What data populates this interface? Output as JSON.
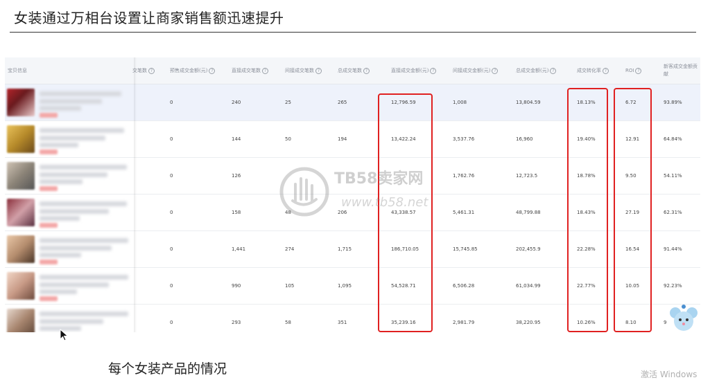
{
  "slide": {
    "title": "女装通过万相台设置让商家销售额迅速提升",
    "caption": "每个女装产品的情况",
    "os_watermark": "激活 Windows"
  },
  "watermark": {
    "line1": "TB58卖家网",
    "line2": "www.tb58.net"
  },
  "table": {
    "headers": [
      "宝贝信息",
      "交笔数",
      "预售成交金额(元)",
      "直接成交笔数",
      "间接成交笔数",
      "总成交笔数",
      "直接成交金额(元)",
      "间接成交金额(元)",
      "总成交金额(元)",
      "成交转化率",
      "ROI",
      "新客成交金额贡献"
    ],
    "rows": [
      {
        "presale": "0",
        "direct_cnt": "240",
        "indirect_cnt": "25",
        "total_cnt": "265",
        "direct_amt": "12,796.59",
        "indirect_amt": "1,008",
        "total_amt": "13,804.59",
        "cvr": "18.13%",
        "roi": "6.72",
        "newcust": "93.89%"
      },
      {
        "presale": "0",
        "direct_cnt": "144",
        "indirect_cnt": "50",
        "total_cnt": "194",
        "direct_amt": "13,422.24",
        "indirect_amt": "3,537.76",
        "total_amt": "16,960",
        "cvr": "19.40%",
        "roi": "12.91",
        "newcust": "64.84%"
      },
      {
        "presale": "0",
        "direct_cnt": "126",
        "indirect_cnt": "",
        "total_cnt": "",
        "direct_amt": "",
        "indirect_amt": "1,762.76",
        "total_amt": "12,723.5",
        "cvr": "18.78%",
        "roi": "9.50",
        "newcust": "54.11%"
      },
      {
        "presale": "0",
        "direct_cnt": "158",
        "indirect_cnt": "48",
        "total_cnt": "206",
        "direct_amt": "43,338.57",
        "indirect_amt": "5,461.31",
        "total_amt": "48,799.88",
        "cvr": "18.43%",
        "roi": "27.19",
        "newcust": "62.31%"
      },
      {
        "presale": "0",
        "direct_cnt": "1,441",
        "indirect_cnt": "274",
        "total_cnt": "1,715",
        "direct_amt": "186,710.05",
        "indirect_amt": "15,745.85",
        "total_amt": "202,455.9",
        "cvr": "22.28%",
        "roi": "16.54",
        "newcust": "91.44%"
      },
      {
        "presale": "0",
        "direct_cnt": "990",
        "indirect_cnt": "105",
        "total_cnt": "1,095",
        "direct_amt": "54,528.71",
        "indirect_amt": "6,506.28",
        "total_amt": "61,034.99",
        "cvr": "22.77%",
        "roi": "10.05",
        "newcust": "92.23%"
      },
      {
        "presale": "0",
        "direct_cnt": "293",
        "indirect_cnt": "58",
        "total_cnt": "351",
        "direct_amt": "35,239.16",
        "indirect_amt": "2,981.79",
        "total_amt": "38,220.95",
        "cvr": "10.26%",
        "roi": "8.10",
        "newcust": "9"
      }
    ]
  },
  "colors": {
    "highlight": "#e02020",
    "selected_row": "#eef2fb",
    "header_bg": "#f4f6f9"
  },
  "icons": {
    "help": "question-circle-icon",
    "watermark_logo": "hand-logo-icon",
    "mascot": "mouse-mascot-icon",
    "cursor": "mouse-cursor-icon"
  }
}
